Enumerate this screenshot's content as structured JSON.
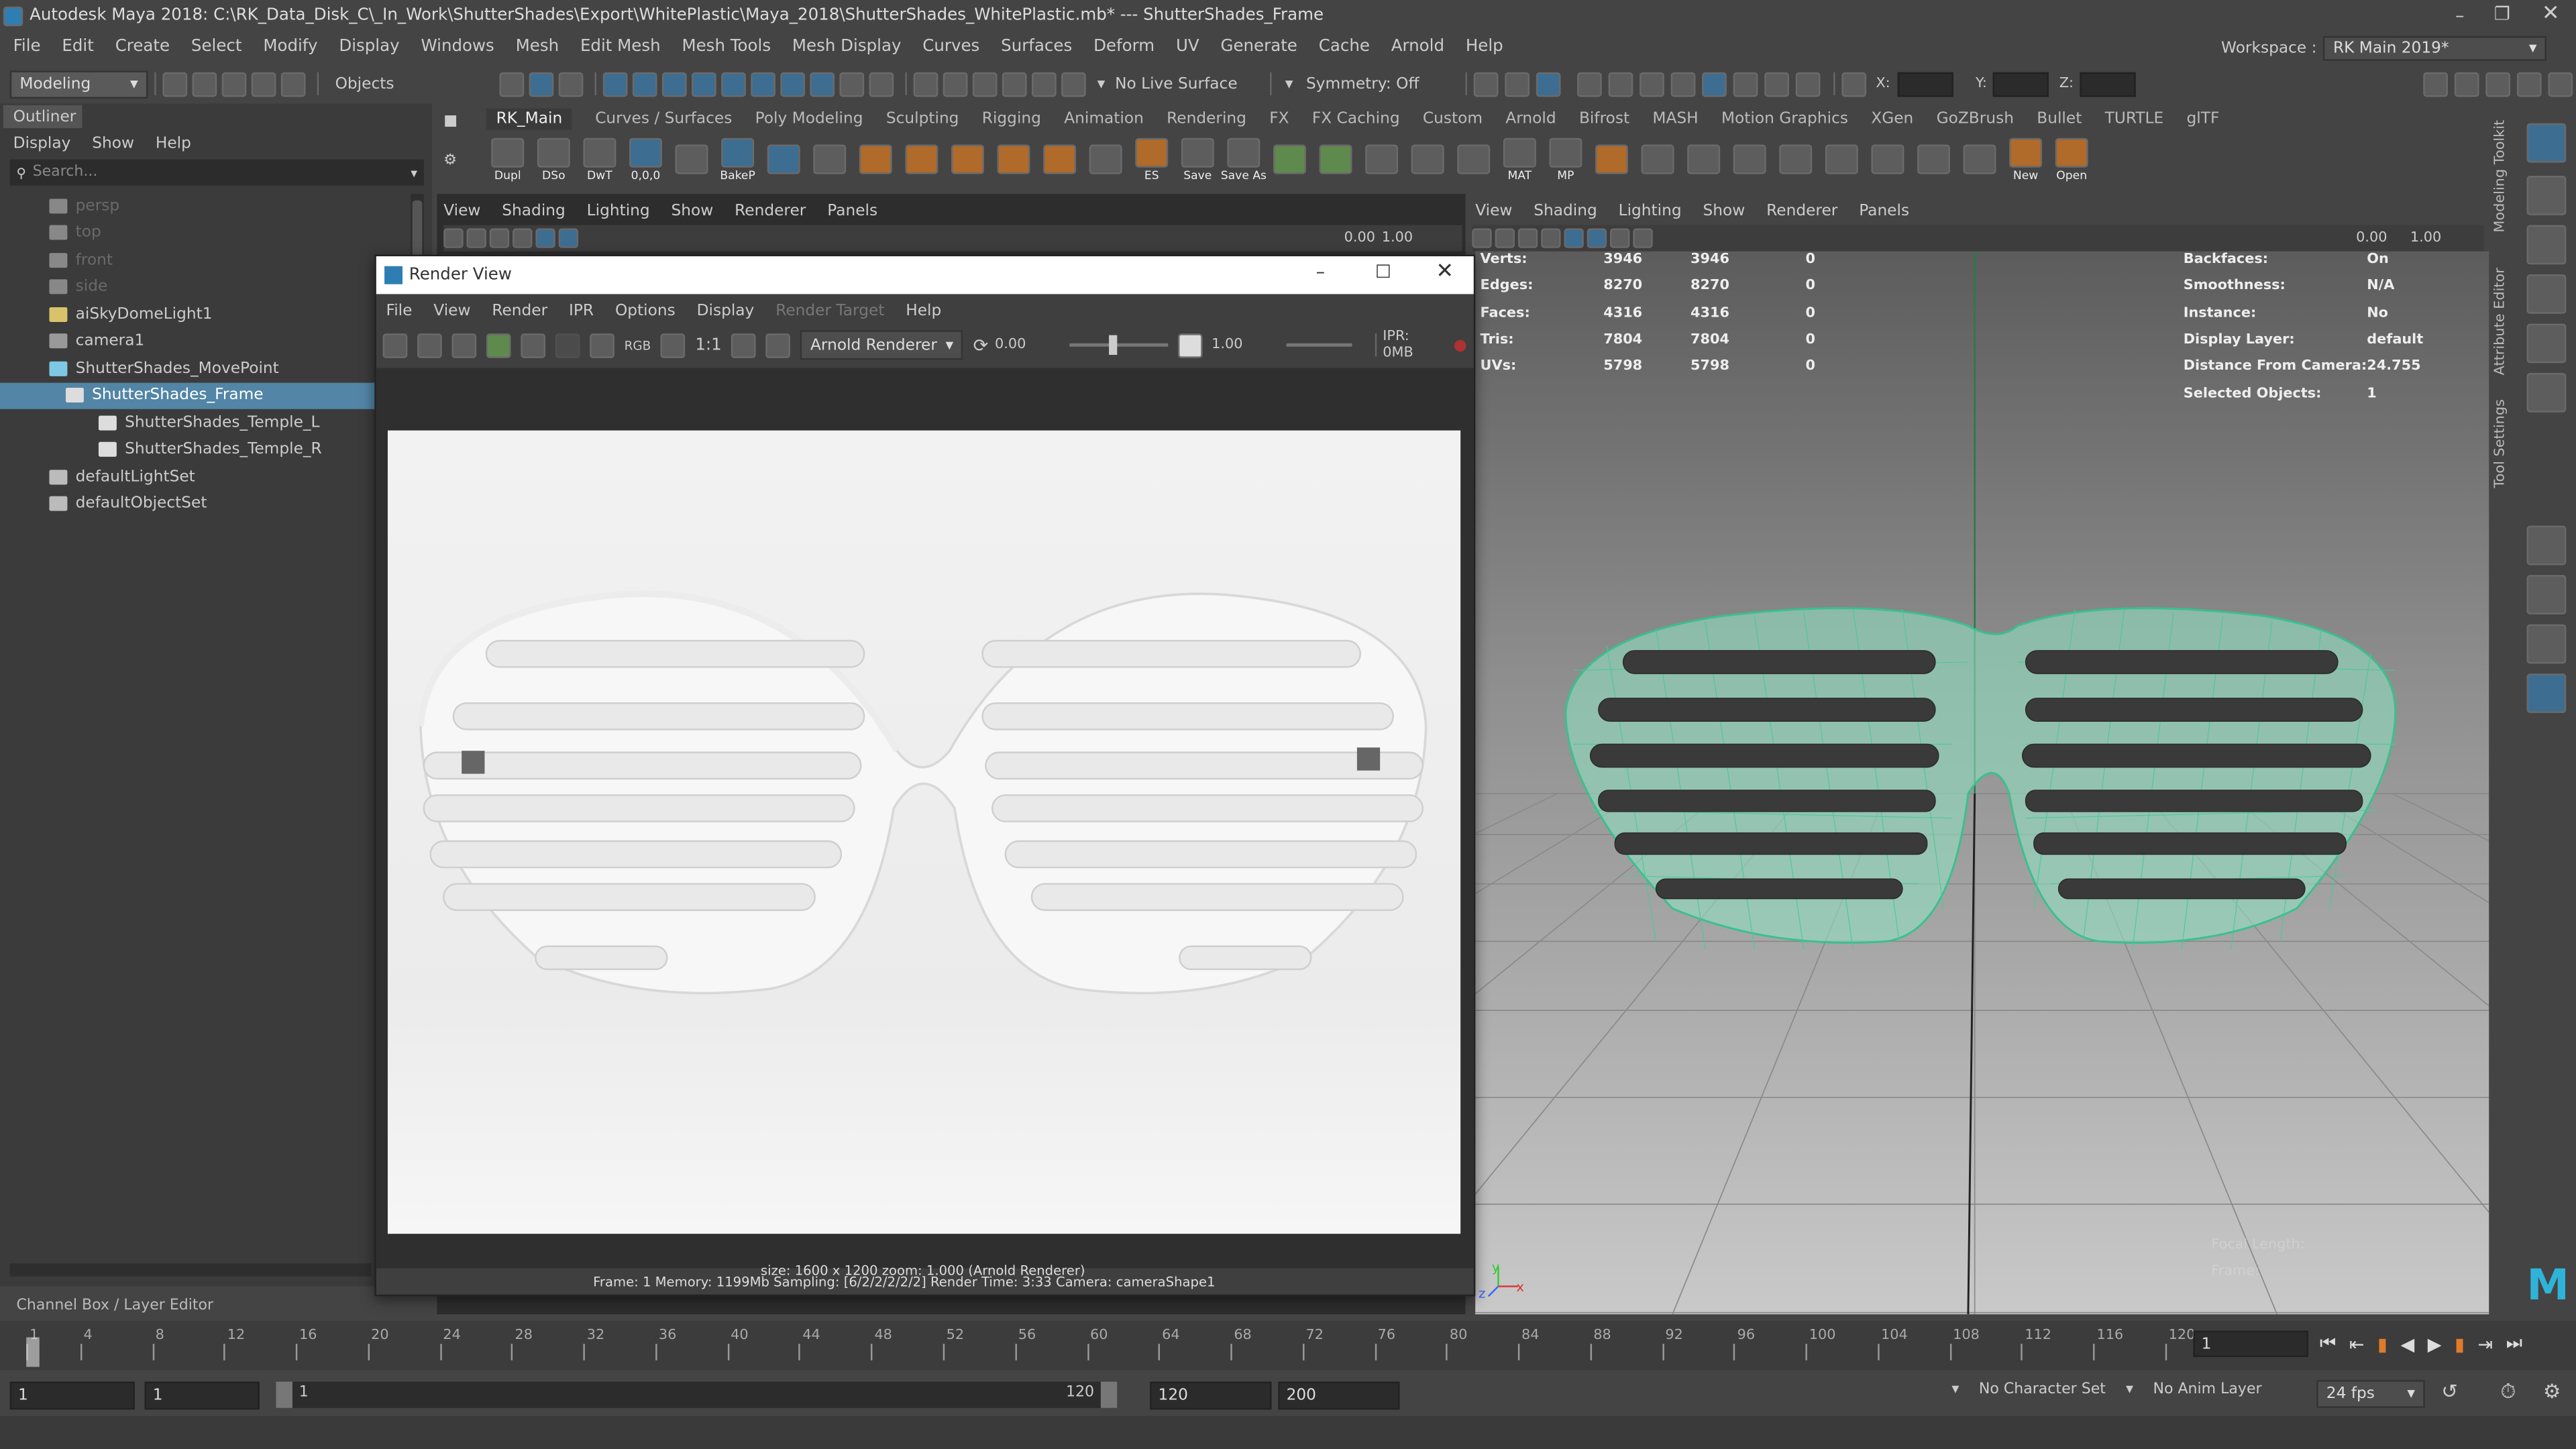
{
  "titlebar": {
    "title": "Autodesk Maya 2018: C:\\RK_Data_Disk_C\\_In_Work\\ShutterShades\\Export\\WhitePlastic\\Maya_2018\\ShutterShades_WhitePlastic.mb*   ---   ShutterShades_Frame"
  },
  "menubar": {
    "items": [
      "File",
      "Edit",
      "Create",
      "Select",
      "Modify",
      "Display",
      "Windows",
      "Mesh",
      "Edit Mesh",
      "Mesh Tools",
      "Mesh Display",
      "Curves",
      "Surfaces",
      "Deform",
      "UV",
      "Generate",
      "Cache",
      "Arnold",
      "Help"
    ],
    "workspace_label": "Workspace :",
    "workspace_value": "RK Main 2019*"
  },
  "statusline": {
    "mode": "Modeling",
    "objects_label": "Objects",
    "live_surface": "No Live Surface",
    "symmetry": "Symmetry: Off",
    "x_label": "X:",
    "y_label": "Y:",
    "z_label": "Z:"
  },
  "outliner": {
    "title": "Outliner",
    "menu": [
      "Display",
      "Show",
      "Help"
    ],
    "search_placeholder": "Search...",
    "items": [
      {
        "label": "persp",
        "dim": true
      },
      {
        "label": "top",
        "dim": true
      },
      {
        "label": "front",
        "dim": true
      },
      {
        "label": "side",
        "dim": true
      },
      {
        "label": "aiSkyDomeLight1",
        "dim": false
      },
      {
        "label": "camera1",
        "dim": false
      },
      {
        "label": "ShutterShades_MovePoint",
        "dim": false
      },
      {
        "label": "ShutterShades_Frame",
        "dim": false,
        "selected": true
      },
      {
        "label": "ShutterShades_Temple_L",
        "dim": false
      },
      {
        "label": "ShutterShades_Temple_R",
        "dim": false
      },
      {
        "label": "defaultLightSet",
        "dim": false
      },
      {
        "label": "defaultObjectSet",
        "dim": false
      }
    ]
  },
  "shelf": {
    "tabs": [
      "RK_Main",
      "Curves / Surfaces",
      "Poly Modeling",
      "Sculpting",
      "Rigging",
      "Animation",
      "Rendering",
      "FX",
      "FX Caching",
      "Custom",
      "Arnold",
      "Bifrost",
      "MASH",
      "Motion Graphics",
      "XGen",
      "GoZBrush",
      "Bullet",
      "TURTLE",
      "glTF"
    ],
    "tools": [
      "Dupl",
      "DSo",
      "DwT",
      "0,0,0",
      "",
      "BakeP",
      "",
      "",
      "",
      "",
      "",
      "",
      "",
      "",
      "ES",
      "Save",
      "Save As",
      "",
      "",
      "",
      "",
      "",
      "MAT",
      "MP",
      "",
      "",
      "",
      "",
      "",
      "",
      "",
      "",
      "",
      "New",
      "Open"
    ]
  },
  "viewport_menus": [
    "View",
    "Shading",
    "Lighting",
    "Show",
    "Renderer",
    "Panels"
  ],
  "viewport_values": {
    "left_a": "0.00",
    "left_b": "1.00",
    "right_a": "0.00",
    "right_b": "1.00"
  },
  "hud": {
    "rows": [
      {
        "label": "Verts:",
        "a": "3946",
        "b": "3946",
        "c": "0"
      },
      {
        "label": "Edges:",
        "a": "8270",
        "b": "8270",
        "c": "0"
      },
      {
        "label": "Faces:",
        "a": "4316",
        "b": "4316",
        "c": "0"
      },
      {
        "label": "Tris:",
        "a": "7804",
        "b": "7804",
        "c": "0"
      },
      {
        "label": "UVs:",
        "a": "5798",
        "b": "5798",
        "c": "0"
      }
    ],
    "right_rows": [
      {
        "label": "Backfaces:",
        "value": "On"
      },
      {
        "label": "Smoothness:",
        "value": "N/A"
      },
      {
        "label": "Instance:",
        "value": "No"
      },
      {
        "label": "Display Layer:",
        "value": "default"
      },
      {
        "label": "Distance From Camera:",
        "value": "24.755"
      },
      {
        "label": "Selected Objects:",
        "value": "1"
      }
    ],
    "bottom_a": "Focal Length:",
    "bottom_b": "Frame:"
  },
  "render_view": {
    "title": "Render View",
    "menu": [
      "File",
      "View",
      "Render",
      "IPR",
      "Options",
      "Display",
      "Render Target",
      "Help"
    ],
    "rgb": "RGB",
    "ratio": "1:1",
    "renderer": "Arnold Renderer",
    "exposure": "0.00",
    "gamma": "1.00",
    "ipr": "IPR: 0MB",
    "status_line1": "size: 1600 x 1200  zoom: 1.000     (Arnold Renderer)",
    "status_line2": "Frame: 1    Memory: 1199Mb    Sampling: [6/2/2/2/2/2]    Render Time: 3:33    Camera: cameraShape1"
  },
  "side_tabs": [
    "Modeling Toolkit",
    "Attribute Editor",
    "Tool Settings"
  ],
  "channel_box_label": "Channel Box / Layer Editor",
  "timeline": {
    "ticks": [
      "1",
      "4",
      "8",
      "12",
      "16",
      "20",
      "24",
      "28",
      "32",
      "36",
      "40",
      "44",
      "48",
      "52",
      "56",
      "60",
      "64",
      "68",
      "72",
      "76",
      "80",
      "84",
      "88",
      "92",
      "96",
      "100",
      "104",
      "108",
      "112",
      "116",
      "120"
    ],
    "current_frame": "1"
  },
  "range": {
    "start": "1",
    "inner_start": "1",
    "slider_start": "1",
    "slider_end": "120",
    "inner_end": "120",
    "end": "200",
    "character_set": "No Character Set",
    "anim_layer": "No Anim Layer",
    "fps": "24 fps"
  },
  "axis": {
    "y": "y",
    "x": "x",
    "z": "z"
  },
  "colors": {
    "accent": "#4a86b8",
    "wire": "#5fe0b4",
    "selected": "#5285a6"
  }
}
